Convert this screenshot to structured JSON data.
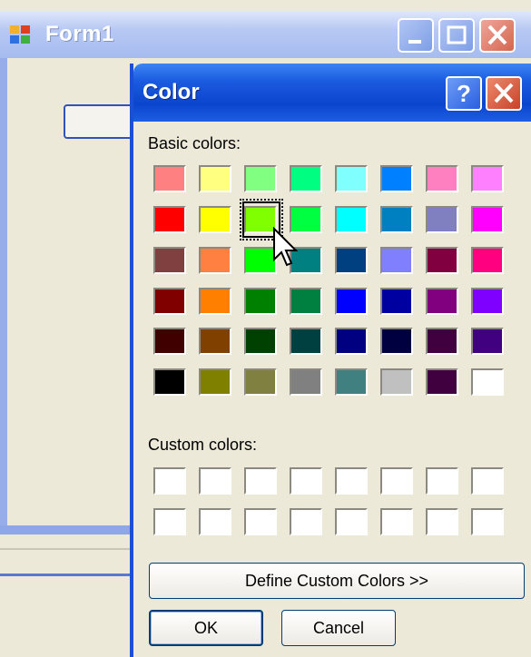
{
  "form1": {
    "title": "Form1"
  },
  "dialog": {
    "title": "Color",
    "help_label": "?",
    "basic_colors_label": "Basic colors:",
    "custom_colors_label": "Custom colors:",
    "define_custom_label": "Define Custom Colors >>",
    "ok_label": "OK",
    "cancel_label": "Cancel"
  },
  "basic_colors": [
    [
      "#ff8080",
      "#ffff80",
      "#80ff80",
      "#00ff80",
      "#80ffff",
      "#0080ff",
      "#ff80c0",
      "#ff80ff"
    ],
    [
      "#ff0000",
      "#ffff00",
      "#80ff00",
      "#00ff40",
      "#00ffff",
      "#0080c0",
      "#8080c0",
      "#ff00ff"
    ],
    [
      "#804040",
      "#ff8040",
      "#00ff00",
      "#008080",
      "#004080",
      "#8080ff",
      "#800040",
      "#ff0080"
    ],
    [
      "#800000",
      "#ff8000",
      "#008000",
      "#008040",
      "#0000ff",
      "#0000a0",
      "#800080",
      "#8000ff"
    ],
    [
      "#400000",
      "#804000",
      "#004000",
      "#004040",
      "#000080",
      "#000040",
      "#400040",
      "#400080"
    ],
    [
      "#000000",
      "#808000",
      "#808040",
      "#808080",
      "#408080",
      "#c0c0c0",
      "#400040",
      "#ffffff"
    ]
  ],
  "selected_color": {
    "row": 1,
    "col": 2
  },
  "custom_colors_count": 16
}
